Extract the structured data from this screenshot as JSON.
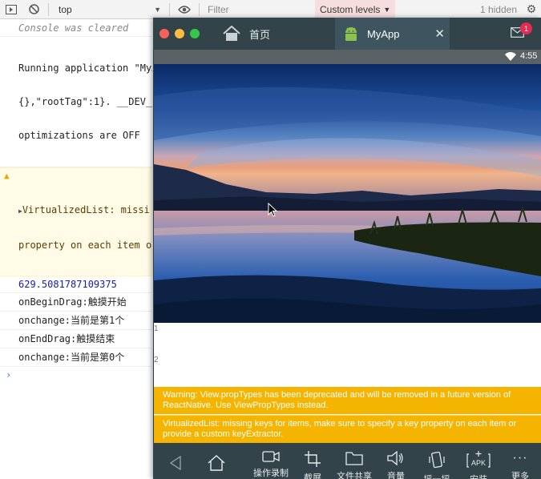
{
  "devtools": {
    "toolbar": {
      "context": "top",
      "filter_placeholder": "Filter",
      "levels_label": "Custom levels",
      "hidden_count": "1 hidden"
    },
    "console": {
      "cleared": "Console was cleared",
      "lines": [
        "Running application \"MyA",
        "{},\"rootTag\":1}. __DEV__",
        "optimizations are OFF"
      ],
      "warning_lines": [
        "VirtualizedList: missi",
        "property on each item o"
      ],
      "logs": [
        "629.5081787109375",
        "onBeginDrag:触摸开始",
        "onchange:当前是第1个",
        "onEndDrag:触摸结束",
        "onchange:当前是第0个"
      ]
    }
  },
  "simulator": {
    "tabs": {
      "home": "首页",
      "app": "MyApp"
    },
    "notification_count": "1",
    "status_time": "4:55",
    "list_items": [
      "1",
      "2"
    ],
    "warnings": [
      "Warning: View.propTypes has been deprecated and will be removed in a future version of ReactNative. Use ViewPropTypes instead.",
      "VirtualizedList: missing keys for items, make sure to specify a key property on each item or provide a custom keyExtractor."
    ],
    "bottom_bar": {
      "record": "操作录制",
      "screenshot": "截屏",
      "file_share": "文件共享",
      "volume": "音量",
      "shake": "摇一摇",
      "install": "安装",
      "more": "更多",
      "apk": "APK"
    }
  },
  "colors": {
    "warning_yellow": "#f5b400",
    "titlebar": "#33434a",
    "active_tab": "#3e5560",
    "badge": "#e82b4f"
  }
}
